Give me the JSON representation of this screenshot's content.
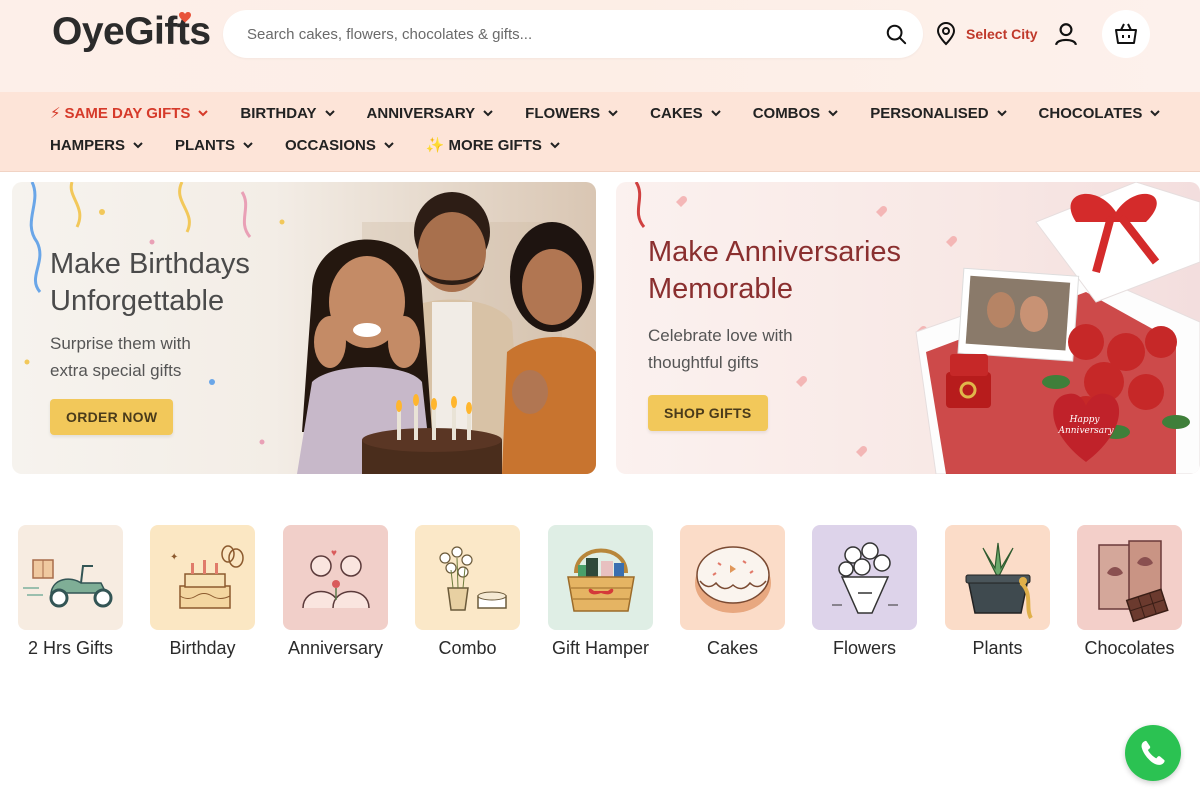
{
  "header": {
    "logo_text": "OyeGifts",
    "search_placeholder": "Search cakes, flowers, chocolates & gifts...",
    "city_label": "Select City",
    "accent_color": "#c0392b"
  },
  "nav": {
    "row1": [
      {
        "label": "SAME DAY GIFTS",
        "emoji": "⚡",
        "hot": true
      },
      {
        "label": "BIRTHDAY"
      },
      {
        "label": "ANNIVERSARY"
      },
      {
        "label": "FLOWERS"
      },
      {
        "label": "CAKES"
      },
      {
        "label": "COMBOS"
      },
      {
        "label": "PERSONALISED"
      },
      {
        "label": "CHOCOLATES"
      }
    ],
    "row2": [
      {
        "label": "HAMPERS"
      },
      {
        "label": "PLANTS"
      },
      {
        "label": "OCCASIONS"
      },
      {
        "label": "MORE GIFTS",
        "emoji": "✨"
      }
    ]
  },
  "banners": [
    {
      "title_line1": "Make Birthdays",
      "title_line2": "Unforgettable",
      "sub_line1": "Surprise them with",
      "sub_line2": "extra special gifts",
      "button": "ORDER NOW"
    },
    {
      "title_line1": "Make Anniversaries",
      "title_line2": "Memorable",
      "sub_line1": "Celebrate love with",
      "sub_line2": "thoughtful gifts",
      "button": "SHOP GIFTS",
      "badge_line1": "Happy",
      "badge_line2": "Anniversary"
    }
  ],
  "categories": [
    {
      "label": "2 Hrs Gifts",
      "icon": "delivery-scooter-icon",
      "bg": "#f7ece1"
    },
    {
      "label": "Birthday",
      "icon": "birthday-cake-icon",
      "bg": "#fbe7c3"
    },
    {
      "label": "Anniversary",
      "icon": "couple-icon",
      "bg": "#f1cfc9"
    },
    {
      "label": "Combo",
      "icon": "flower-vase-cake-icon",
      "bg": "#fbe8c8"
    },
    {
      "label": "Gift Hamper",
      "icon": "gift-basket-icon",
      "bg": "#dfeee5"
    },
    {
      "label": "Cakes",
      "icon": "cake-icon",
      "bg": "#fbdcc8"
    },
    {
      "label": "Flowers",
      "icon": "bouquet-icon",
      "bg": "#ddd3ea"
    },
    {
      "label": "Plants",
      "icon": "potted-plant-icon",
      "bg": "#fbdcc8"
    },
    {
      "label": "Chocolates",
      "icon": "chocolate-bar-icon",
      "bg": "#f3cfc9"
    }
  ]
}
